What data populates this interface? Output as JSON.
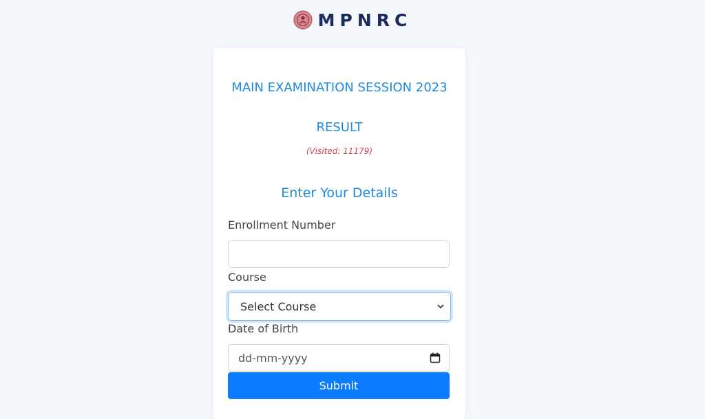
{
  "header": {
    "logo_icon": "emblem-icon",
    "logo_text": "MPNRC"
  },
  "card": {
    "exam_title": "MAIN EXAMINATION SESSION 2023",
    "result_title": "RESULT",
    "visited_text": "(Visited: 11179)",
    "form_title": "Enter Your Details"
  },
  "form": {
    "enrollment_label": "Enrollment Number",
    "enrollment_value": "",
    "course_label": "Course",
    "course_selected": "Select Course",
    "dob_label": "Date of Birth",
    "dob_placeholder": "dd-mm-yyyy",
    "submit_label": "Submit"
  },
  "colors": {
    "accent": "#1e8ae0",
    "button": "#0b7bff",
    "visited": "#d0455b",
    "logo_text": "#1a2b5c",
    "background": "#f4f7fc"
  }
}
